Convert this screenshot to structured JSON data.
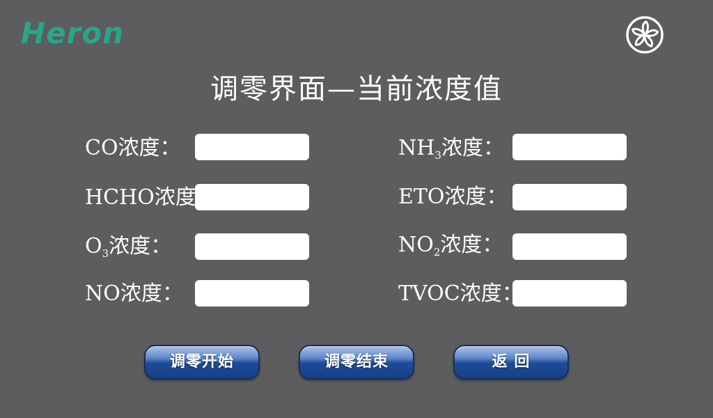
{
  "brand": {
    "logo_text": "Heron"
  },
  "header": {
    "fan_icon": "fan-icon",
    "title": "调零界面—当前浓度值"
  },
  "readings": {
    "co": {
      "prefix": "CO",
      "sub": "",
      "suffix": "浓度：",
      "value": ""
    },
    "nh3": {
      "prefix": "NH",
      "sub": "3",
      "suffix": "浓度：",
      "value": ""
    },
    "hcho": {
      "prefix": "HCHO",
      "sub": "",
      "suffix": "浓度：",
      "value": ""
    },
    "eto": {
      "prefix": "ETO",
      "sub": "",
      "suffix": "浓度：",
      "value": ""
    },
    "o3": {
      "prefix": "O",
      "sub": "3",
      "suffix": "浓度：",
      "value": ""
    },
    "no2": {
      "prefix": "NO",
      "sub": "2",
      "suffix": "浓度：",
      "value": ""
    },
    "no": {
      "prefix": "NO",
      "sub": "",
      "suffix": "浓度：",
      "value": ""
    },
    "tvoc": {
      "prefix": "TVOC",
      "sub": "",
      "suffix": "浓度：",
      "value": ""
    }
  },
  "actions": {
    "start_zero": "调零开始",
    "end_zero": "调零结束",
    "back": "返 回"
  },
  "colors": {
    "background": "#5d5c5e",
    "logo": "#2aa58a",
    "button_blue": "#1f4d9a"
  }
}
